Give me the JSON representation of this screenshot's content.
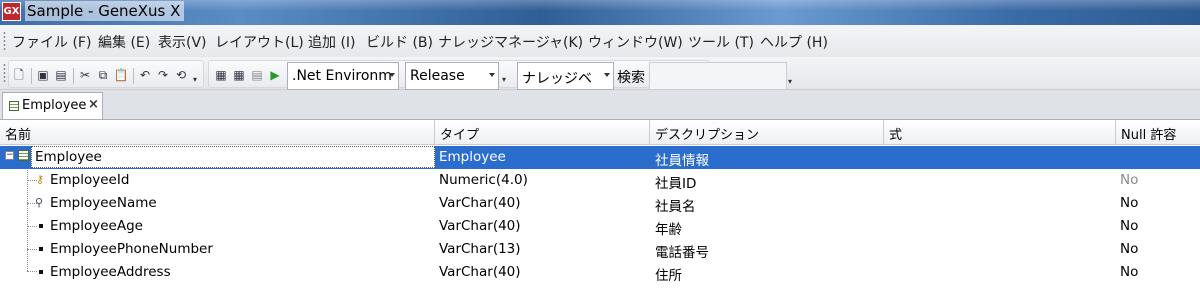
{
  "window": {
    "logo": "GX",
    "title": "Sample - GeneXus X"
  },
  "menubar": {
    "items": [
      "ファイル (F)",
      "編集 (E)",
      "表示(V)",
      "レイアウト(L)",
      "追加 (I)",
      "ビルド (B)",
      "ナレッジマネージャ(K)",
      "ウィンドウ(W)",
      "ツール (T)",
      "ヘルプ (H)"
    ]
  },
  "toolbar": {
    "environment_value": ".Net Environm",
    "configuration_value": "Release",
    "knowledge_base_value": "ナレッジベ",
    "search_label": "検索",
    "search_value": "",
    "icons": [
      "new-object-icon",
      "save-icon",
      "save-all-icon",
      "cut-icon",
      "copy-icon",
      "paste-icon",
      "undo-icon",
      "redo-icon",
      "history-icon",
      "build-icon",
      "build-all-icon",
      "rebuild-icon",
      "run-icon"
    ]
  },
  "tabs": [
    {
      "label": "Employee",
      "close": "×",
      "active": true
    }
  ],
  "grid": {
    "columns": [
      "名前",
      "タイプ",
      "デスクリプション",
      "式",
      "Null 許容"
    ],
    "root": {
      "name": "Employee",
      "type": "Employee",
      "description": "社員情報",
      "formula": "",
      "nullable": "",
      "expander": "−"
    },
    "rows": [
      {
        "name": "EmployeeId",
        "type": "Numeric(4.0)",
        "description": "社員ID",
        "formula": "",
        "nullable": "No",
        "icon": "key-icon"
      },
      {
        "name": "EmployeeName",
        "type": "VarChar(40)",
        "description": "社員名",
        "formula": "",
        "nullable": "No",
        "icon": "description-attribute-icon"
      },
      {
        "name": "EmployeeAge",
        "type": "VarChar(40)",
        "description": "年齢",
        "formula": "",
        "nullable": "No",
        "icon": "attribute-icon"
      },
      {
        "name": "EmployeePhoneNumber",
        "type": "VarChar(13)",
        "description": "電話番号",
        "formula": "",
        "nullable": "No",
        "icon": "attribute-icon"
      },
      {
        "name": "EmployeeAddress",
        "type": "VarChar(40)",
        "description": "住所",
        "formula": "",
        "nullable": "No",
        "icon": "attribute-icon"
      }
    ]
  },
  "colors": {
    "selection": "#2b6dcc",
    "titlebar": "#3d6ea8",
    "null_text": "#8a8a8a"
  }
}
